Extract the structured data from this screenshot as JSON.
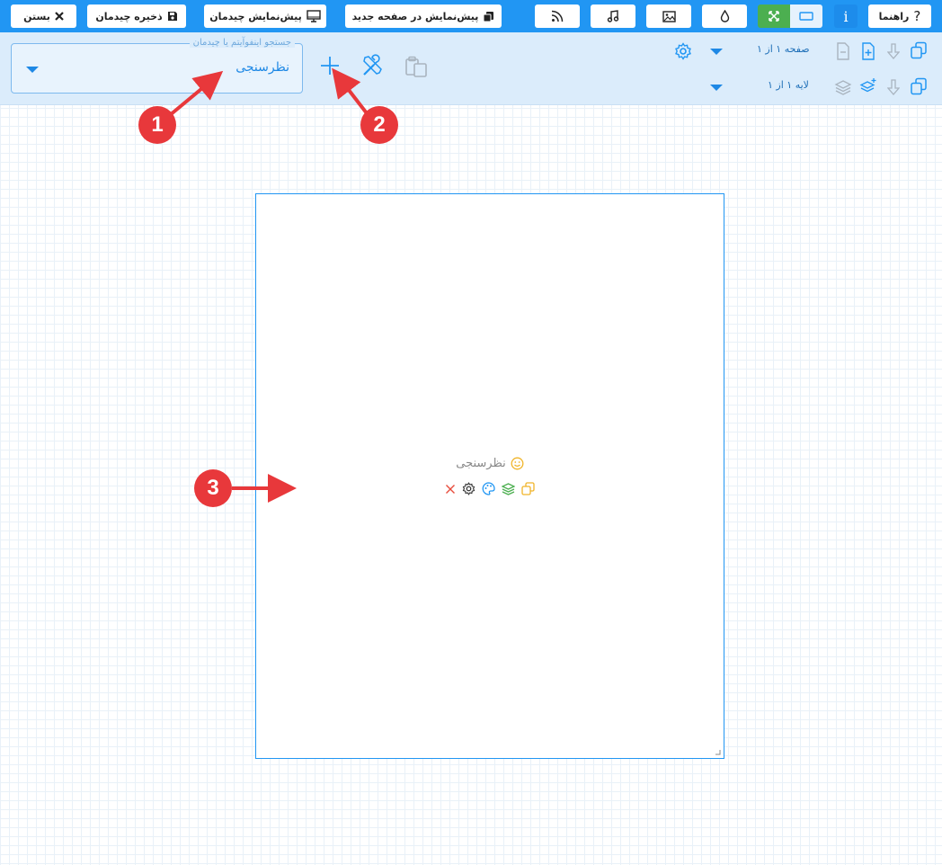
{
  "topbar": {
    "close_label": "بستن",
    "save_layout_label": "ذخیره چیدمان",
    "preview_layout_label": "پیش‌نمایش چیدمان",
    "preview_new_page_label": "پیش‌نمایش در صفحه جدید",
    "help_label": "راهنما",
    "info_glyph": "i",
    "icons": [
      "close-icon",
      "save-icon",
      "monitor-icon",
      "copy-icon",
      "rss-icon",
      "music-icon",
      "image-icon",
      "drop-icon",
      "expand-icon",
      "rectangle-icon",
      "info-icon",
      "question-icon"
    ]
  },
  "toolbar": {
    "search_legend": "جستجو اینفوآیتم یا چیدمان",
    "search_value": "نظرسنجی",
    "page_info": "صفحه ۱ از ۱",
    "layer_info": "لایه ۱ از ۱"
  },
  "canvas": {
    "widget_title": "نظرسنجی",
    "widget_icons": [
      "smile-icon",
      "close-icon",
      "gear-icon",
      "palette-icon",
      "layers-icon",
      "copy-icon"
    ]
  },
  "callouts": {
    "one": "1",
    "two": "2",
    "three": "3"
  },
  "colors": {
    "primary": "#2196f3",
    "callout": "#e8383b",
    "active_green": "#4caf50"
  }
}
